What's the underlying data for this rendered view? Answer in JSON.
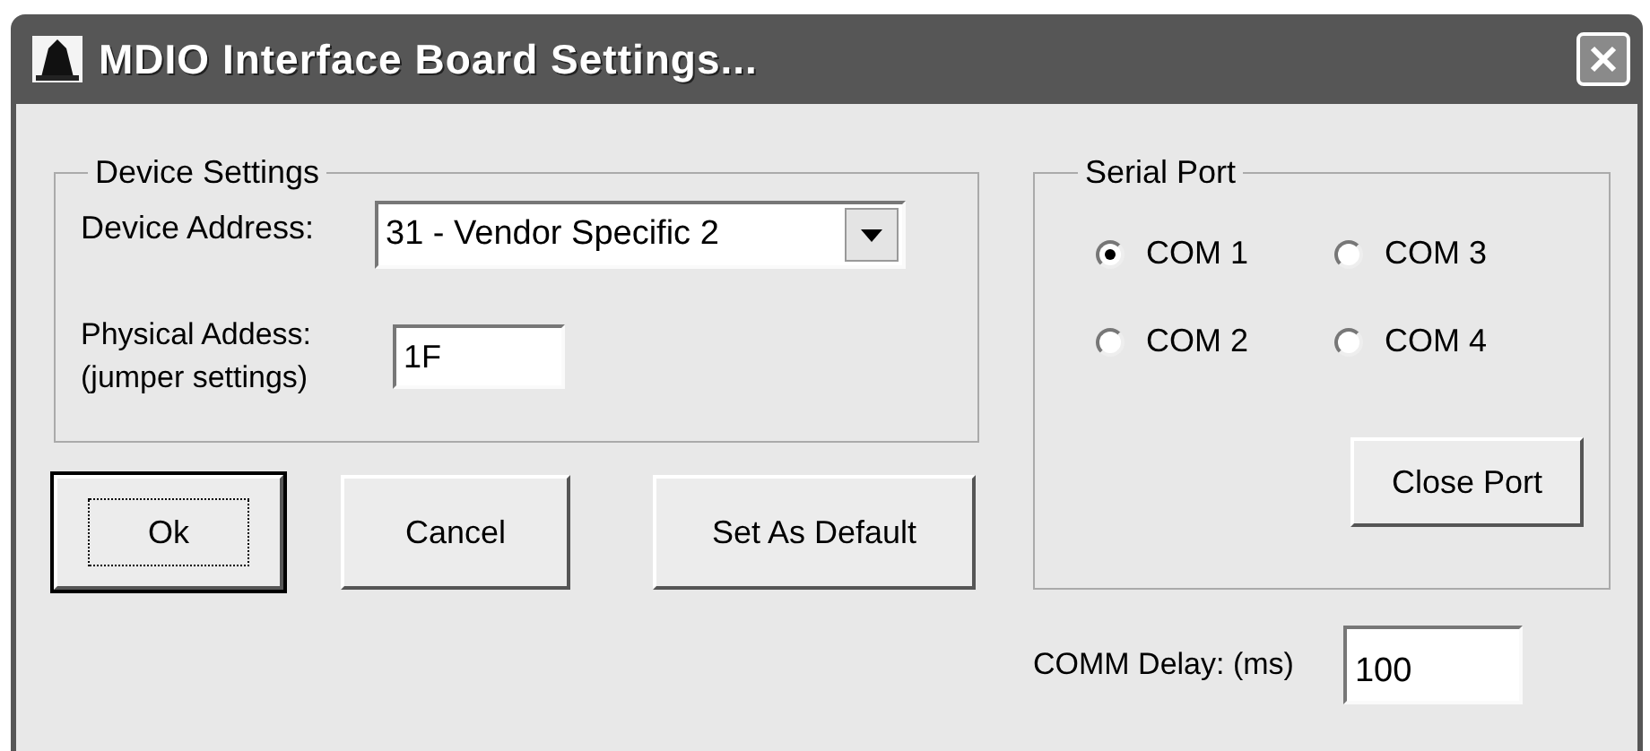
{
  "window": {
    "title": "MDIO Interface Board Settings..."
  },
  "device_settings": {
    "legend": "Device Settings",
    "device_address": {
      "label": "Device Address:",
      "value": "31 - Vendor Specific 2"
    },
    "physical_address": {
      "label_lines": [
        "Physical Addess:",
        "(jumper settings)"
      ],
      "value": "1F"
    }
  },
  "buttons": [
    {
      "label": "Ok",
      "default": true
    },
    {
      "label": "Cancel",
      "default": false
    },
    {
      "label": "Set As Default",
      "default": false
    }
  ],
  "serial_port": {
    "legend": "Serial Port",
    "ports": [
      {
        "label": "COM 1",
        "selected": true
      },
      {
        "label": "COM 3",
        "selected": false
      },
      {
        "label": "COM 2",
        "selected": false
      },
      {
        "label": "COM 4",
        "selected": false
      }
    ],
    "button": "Close Port"
  },
  "comm_delay": {
    "label": "COMM Delay: (ms)",
    "value": "100"
  }
}
